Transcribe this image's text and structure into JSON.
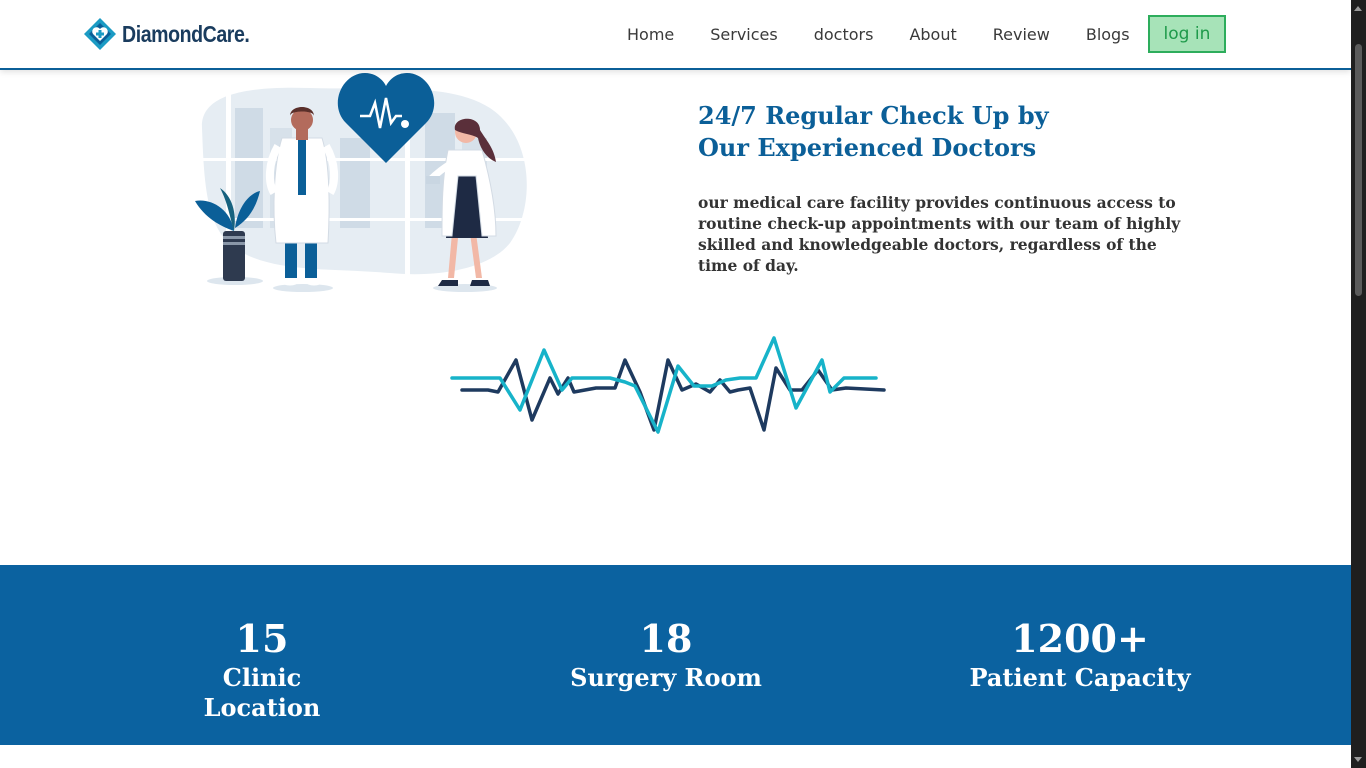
{
  "brand": {
    "name": "DiamondCare.",
    "logo_icon": "diamond-heart-icon"
  },
  "nav": {
    "links": [
      "Home",
      "Services",
      "doctors",
      "About",
      "Review",
      "Blogs"
    ],
    "login_label": "log in"
  },
  "feature": {
    "headline_line1": "24/7 Regular Check Up by",
    "headline_line2": "Our Experienced Doctors",
    "description": "our medical care facility provides continuous access to routine check-up appointments with our team of highly skilled and knowledgeable doctors, regardless of the time of day."
  },
  "stats": [
    {
      "number": "15",
      "label": "Clinic Location"
    },
    {
      "number": "18",
      "label": "Surgery Room"
    },
    {
      "number": "1200+",
      "label": "Patient Capacity"
    }
  ],
  "colors": {
    "primary": "#0b5f98",
    "stats_bg": "#0b62a0",
    "login_bg": "#a7e3b8",
    "login_text": "#1e9a4a",
    "heartbeat_cyan": "#17b3c9",
    "heartbeat_navy": "#1e3a5f"
  }
}
